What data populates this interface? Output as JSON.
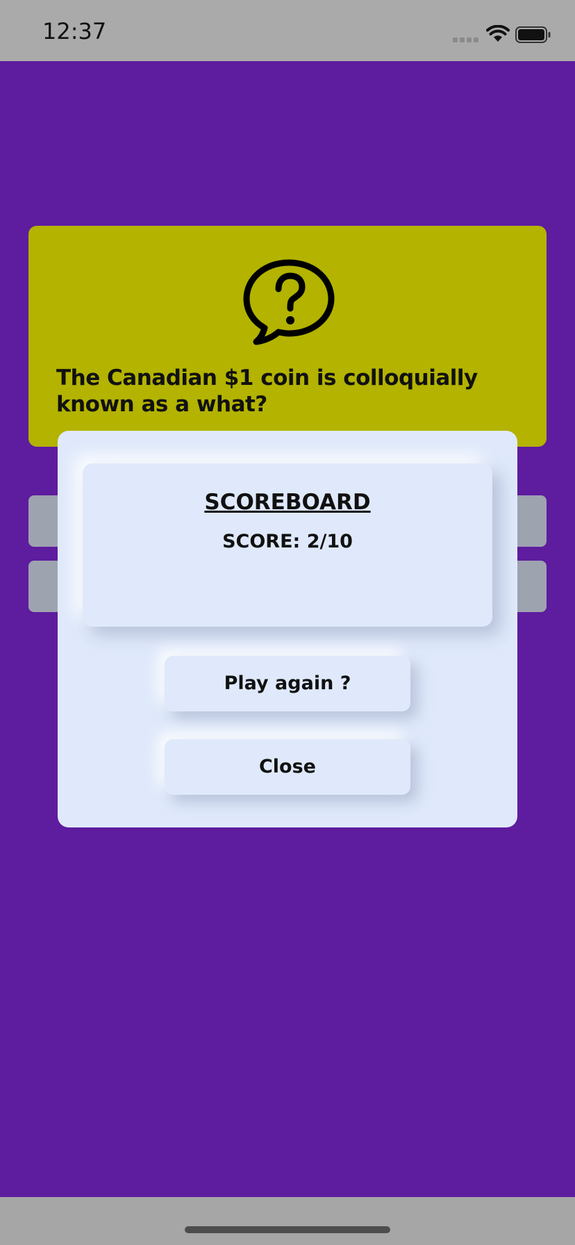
{
  "status_bar": {
    "time": "12:37",
    "icons": [
      "signal-icon",
      "wifi-icon",
      "battery-icon"
    ]
  },
  "question": {
    "icon": "speech-bubble-question-icon",
    "text": "The Canadian $1 coin is colloquially known as a what?"
  },
  "answers": [
    {
      "label": ""
    },
    {
      "label": ""
    }
  ],
  "modal": {
    "title": "SCOREBOARD",
    "score": "SCORE: 2/10",
    "play_again_label": "Play again ?",
    "close_label": "Close"
  },
  "colors": {
    "background": "#5e1c9e",
    "question_card": "#b3b300",
    "modal": "#dfe9fb",
    "answer_button": "#9ea3b0",
    "status_bar": "#aaaaaa"
  }
}
